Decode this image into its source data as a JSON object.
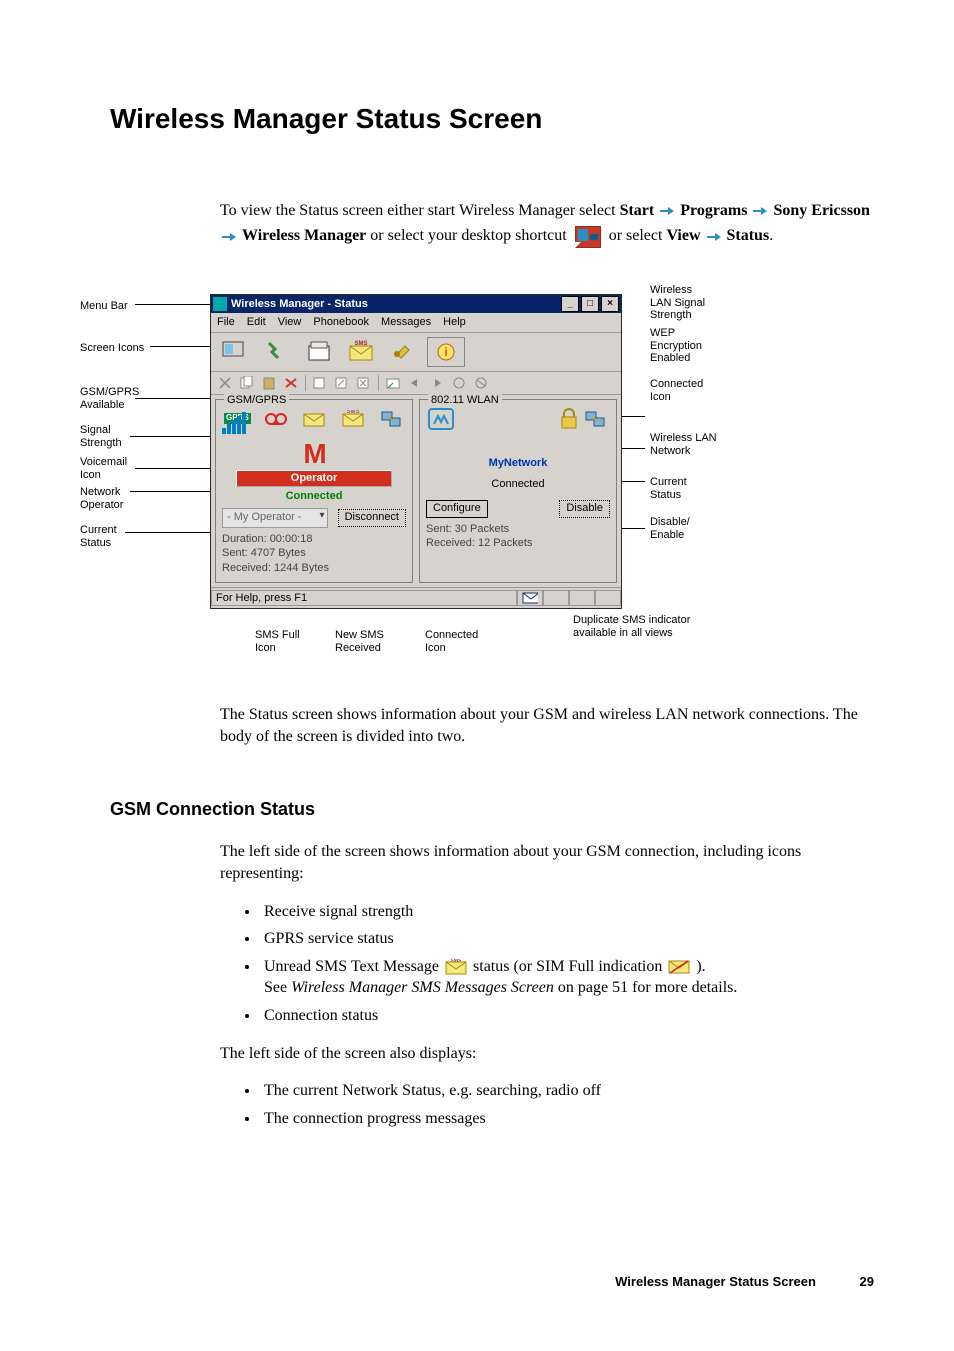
{
  "page_title": "Wireless Manager Status Screen",
  "intro": {
    "p1_a": "To view the Status screen either start Wireless Manager select ",
    "start": "Start",
    "programs": "Programs",
    "sony": "Sony Ericsson",
    "wm": "Wireless Manager",
    "p1_b": " or select your desktop shortcut ",
    "p1_c": " or select ",
    "view": "View",
    "status": "Status",
    "period": "."
  },
  "labels": {
    "menu_bar": "Menu Bar",
    "screen_icons": "Screen Icons",
    "gsm_avail": "GSM/GPRS\nAvailable",
    "signal_strength": "Signal\nStrength",
    "voicemail_icon": "Voicemail\nIcon",
    "network_operator": "Network\nOperator",
    "current_status": "Current\nStatus",
    "sms_full_icon": "SMS Full\nIcon",
    "new_sms_received": "New SMS\nReceived",
    "connected_icon": "Connected\nIcon",
    "wlan_signal": "Wireless\nLAN Signal\nStrength",
    "wep_enabled": "WEP\nEncryption\nEnabled",
    "connected_icon_r": "Connected\nIcon",
    "wlan_network": "Wireless LAN\nNetwork",
    "current_status_r": "Current\nStatus",
    "disable_enable": "Disable/\nEnable",
    "dup_sms": "Duplicate SMS indicator\navailable in all views"
  },
  "window": {
    "title": "Wireless Manager - Status",
    "win_controls": {
      "min": "_",
      "max": "□",
      "close": "×"
    },
    "menu": [
      "File",
      "Edit",
      "View",
      "Phonebook",
      "Messages",
      "Help"
    ],
    "gsm": {
      "group_title": "GSM/GPRS",
      "m_logo": "M",
      "operator_label": "Operator",
      "status": "Connected",
      "select": "- My Operator -",
      "disconnect": "Disconnect",
      "duration": "Duration: 00:00:18",
      "sent": "Sent: 4707 Bytes",
      "received": "Received: 1244 Bytes"
    },
    "wlan": {
      "group_title": "802.11 WLAN",
      "network": "MyNetwork",
      "status": "Connected",
      "configure": "Configure",
      "disable": "Disable",
      "sent": "Sent: 30 Packets",
      "received": "Received: 12 Packets"
    },
    "statusbar": {
      "help": "For Help, press F1"
    }
  },
  "body": {
    "p_status": "The Status screen shows information about your GSM and wireless LAN network connections. The body of the screen is divided into two.",
    "h_gsm": "GSM Connection Status",
    "p_gsm_left": "The left side of the screen shows information about your GSM connection, including icons representing:",
    "li1": "Receive signal strength",
    "li2": "GPRS service status",
    "li3_a": "Unread SMS Text Message ",
    "li3_b": " status (or SIM Full indication ",
    "li3_c": ").",
    "li3_see": "See ",
    "li3_link": "Wireless Manager SMS Messages Screen",
    "li3_tail": " on page 51 for more details.",
    "li4": "Connection status",
    "p_also": "The left side of the screen also displays:",
    "li5": "The current Network Status, e.g. searching, radio off",
    "li6": "The connection progress messages"
  },
  "footer": {
    "title": "Wireless Manager Status Screen",
    "page": "29"
  }
}
